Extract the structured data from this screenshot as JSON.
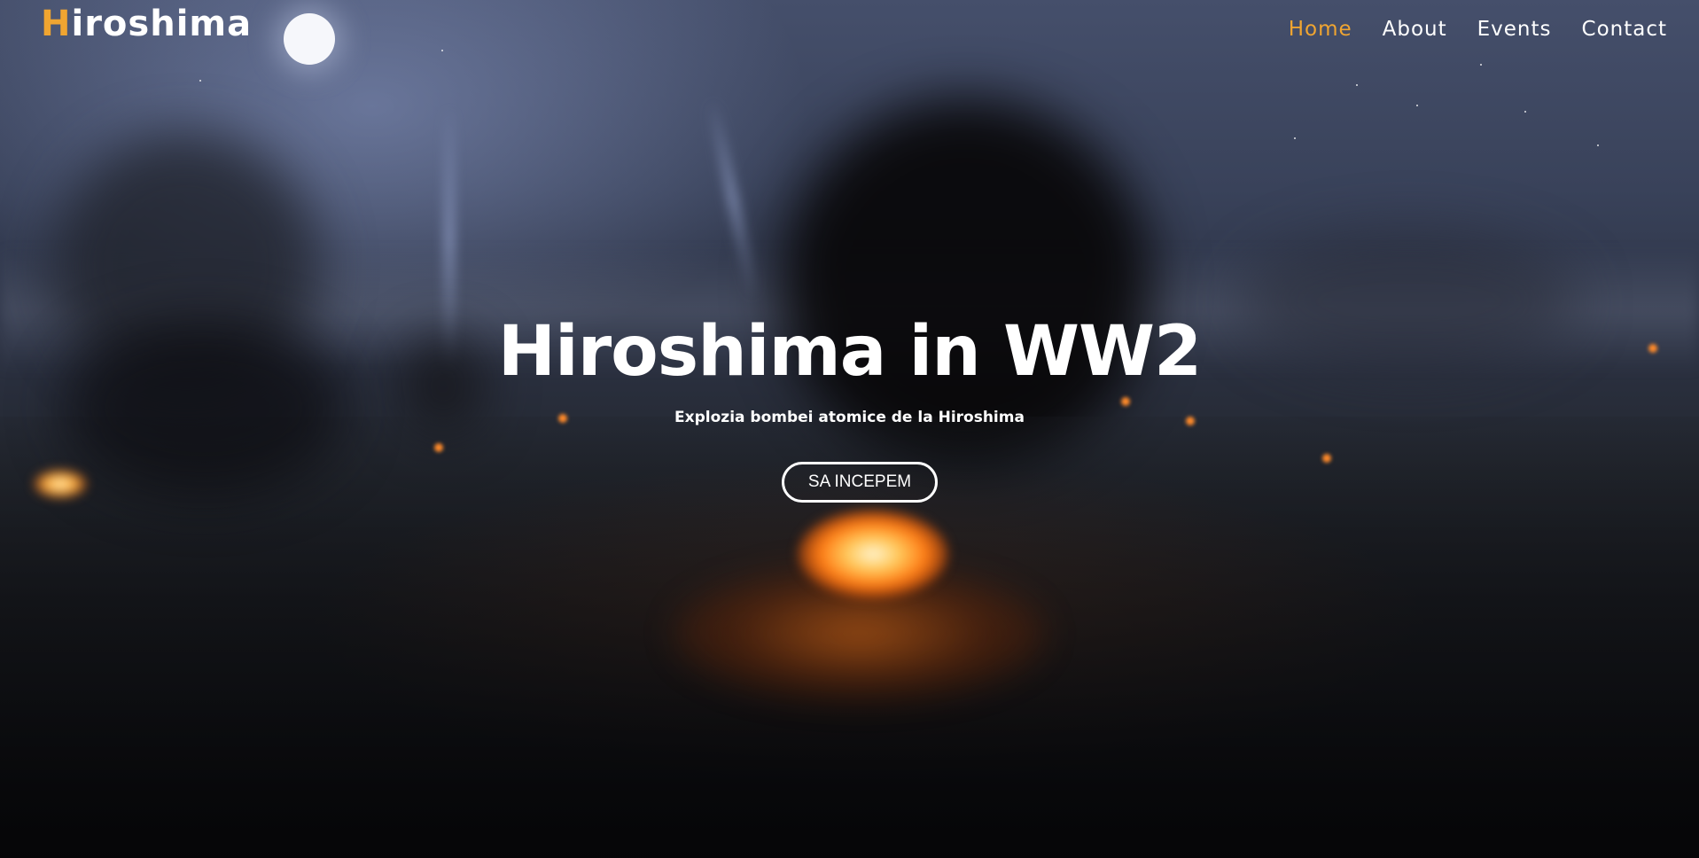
{
  "header": {
    "logo_initial": "H",
    "logo_rest": "iroshima",
    "nav": [
      {
        "label": "Home",
        "active": true
      },
      {
        "label": "About",
        "active": false
      },
      {
        "label": "Events",
        "active": false
      },
      {
        "label": "Contact",
        "active": false
      }
    ]
  },
  "hero": {
    "title": "Hiroshima in WW2",
    "subtitle": "Explozia bombei atomice de la Hiroshima",
    "cta_label": "SA INCEPEM"
  },
  "colors": {
    "accent": "#f0a531",
    "text": "#ffffff"
  }
}
